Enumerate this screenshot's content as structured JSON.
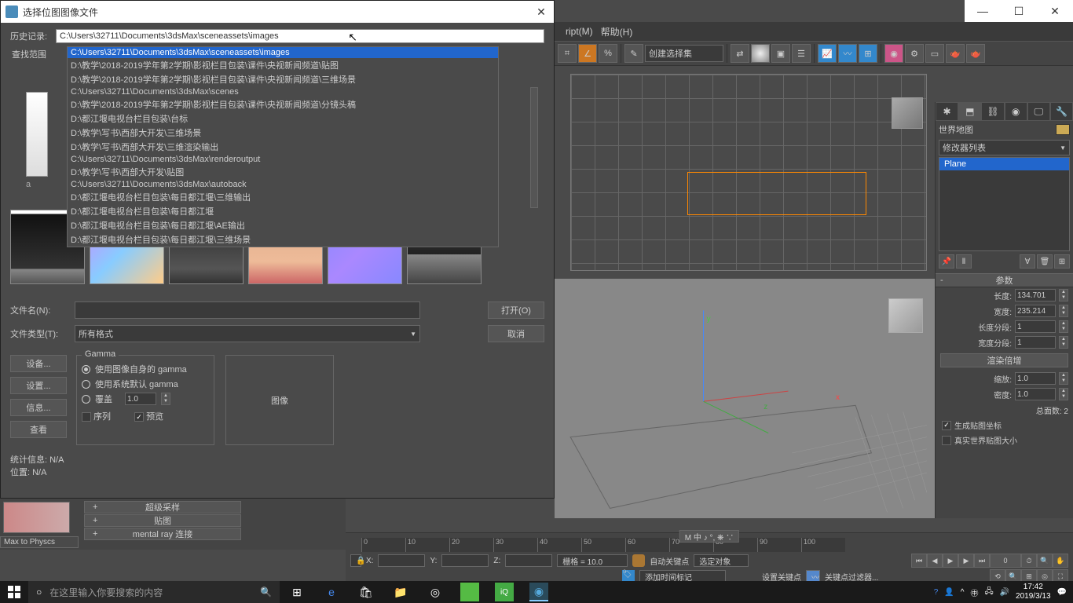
{
  "window_controls": {
    "min": "—",
    "max": "☐",
    "close": "✕"
  },
  "menu": {
    "script": "ript(M)",
    "help": "帮助(H)"
  },
  "toolbar": {
    "selection_set": "创建选择集"
  },
  "dialog": {
    "title": "选择位图图像文件",
    "history_label": "历史记录:",
    "lookin_label": "查找范围",
    "history_path": "C:\\Users\\32711\\Documents\\3dsMax\\sceneassets\\images",
    "history_options": [
      "C:\\Users\\32711\\Documents\\3dsMax\\sceneassets\\images",
      "D:\\教学\\2018-2019学年第2学期\\影视栏目包装\\课件\\央视新闻频道\\贴图",
      "D:\\教学\\2018-2019学年第2学期\\影视栏目包装\\课件\\央视新闻频道\\三维场景",
      "C:\\Users\\32711\\Documents\\3dsMax\\scenes",
      "D:\\教学\\2018-2019学年第2学期\\影视栏目包装\\课件\\央视新闻频道\\分镜头稿",
      "D:\\都江堰电视台栏目包装\\台标",
      "D:\\教学\\写书\\西部大开发\\三维场景",
      "D:\\教学\\写书\\西部大开发\\三维渲染输出",
      "C:\\Users\\32711\\Documents\\3dsMax\\renderoutput",
      "D:\\教学\\写书\\西部大开发\\贴图",
      "C:\\Users\\32711\\Documents\\3dsMax\\autoback",
      "D:\\都江堰电视台栏目包装\\每日都江堰\\三维输出",
      "D:\\都江堰电视台栏目包装\\每日都江堰",
      "D:\\都江堰电视台栏目包装\\每日都江堰\\AE输出",
      "D:\\都江堰电视台栏目包装\\每日都江堰\\三维场景"
    ],
    "filename_label": "文件名(N):",
    "filetype_label": "文件类型(T):",
    "filetype_value": "所有格式",
    "open_btn": "打开(O)",
    "cancel_btn": "取消",
    "devices_btn": "设备...",
    "setup_btn": "设置...",
    "info_btn": "信息...",
    "view_btn": "查看",
    "gamma_legend": "Gamma",
    "gamma_auto": "使用图像自身的 gamma",
    "gamma_system": "使用系统默认 gamma",
    "gamma_override": "覆盖",
    "gamma_value": "1.0",
    "sequence": "序列",
    "preview": "预览",
    "preview_label": "图像",
    "stats": "统计信息: N/A",
    "location": "位置: N/A"
  },
  "lower_left": {
    "supersample": "超级采样",
    "mapping": "贴图",
    "mentalray": "mental ray 连接",
    "physx": "Max to Physcs"
  },
  "cmd_panel": {
    "worldmap": "世界地图",
    "modlist_label": "修改器列表",
    "modifier": "Plane",
    "rollout_params": "参数",
    "length_label": "长度:",
    "length_val": "134.701",
    "width_label": "宽度:",
    "width_val": "235.214",
    "lenseg_label": "长度分段:",
    "lenseg_val": "1",
    "widseg_label": "宽度分段:",
    "widseg_val": "1",
    "rendermult_label": "渲染倍增",
    "scale_label": "缩放:",
    "scale_val": "1.0",
    "density_label": "密度:",
    "density_val": "1.0",
    "totalfaces": "总面数: 2",
    "genmap": "生成贴图坐标",
    "realworld": "真实世界贴图大小"
  },
  "timeline": {
    "ticks": [
      "0",
      "10",
      "20",
      "30",
      "40",
      "50",
      "60",
      "70",
      "80",
      "90",
      "100"
    ],
    "display": "M 中 ♪ °, ❋ ∵"
  },
  "status": {
    "x": "X:",
    "y": "Y:",
    "z": "Z:",
    "grid": "栅格 = 10.0",
    "autokey": "自动关键点",
    "set_obj": "选定对象",
    "setkey": "设置关键点",
    "keyfilter": "关键点过滤器...",
    "addtime": "添加时间标记"
  },
  "taskbar": {
    "search_placeholder": "在这里输入你要搜索的内容",
    "time": "17:42",
    "date": "2019/3/13"
  }
}
